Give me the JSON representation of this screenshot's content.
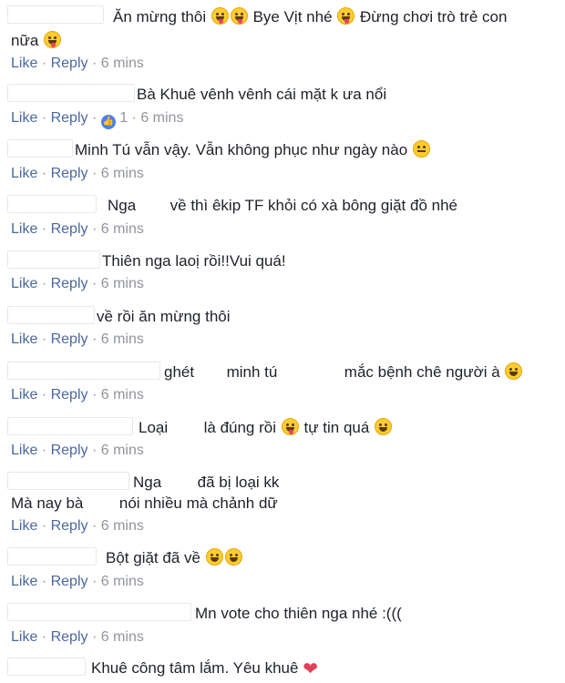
{
  "actions": {
    "like": "Like",
    "reply": "Reply",
    "separator": "·",
    "time": "6 mins",
    "like_count": "1"
  },
  "comments": [
    {
      "line1": [
        "Ăn mừng thôi",
        "Bye Vịt nhé",
        "Đừng chơi trò trẻ con"
      ],
      "line2": "nữa"
    },
    {
      "line1": "Bà Khuê vênh vênh cái mặt k ưa nổi"
    },
    {
      "line1": "Minh Tú vẫn vậy. Vẫn không phục như ngày nào"
    },
    {
      "line1": [
        "Nga",
        "về thì êkip TF khỏi có xà bông giặt đồ nhé"
      ]
    },
    {
      "line1": "Thiên nga laoị rồi!!Vui quá!"
    },
    {
      "line1": "về rồi ăn mừng thôi"
    },
    {
      "line1": [
        "ghét",
        "minh tú",
        "mắc bệnh chê người à"
      ]
    },
    {
      "line1": [
        "Loại",
        "là đúng rồi",
        "tự tin quá"
      ]
    },
    {
      "line1": [
        "Nga",
        "đã bị loại kk"
      ],
      "line2": [
        "Mà nay bà",
        "nói nhiều mà chảnh dữ"
      ]
    },
    {
      "line1": "Bột giặt đã về"
    },
    {
      "line1": "Mn vote cho thiên nga nhé :((("
    },
    {
      "line1": "Khuê công tâm lắm. Yêu khuê"
    }
  ],
  "icons": {
    "emoji": "emoji-face-icon",
    "heart": "heart-icon",
    "like_badge": "like-thumb-icon"
  }
}
